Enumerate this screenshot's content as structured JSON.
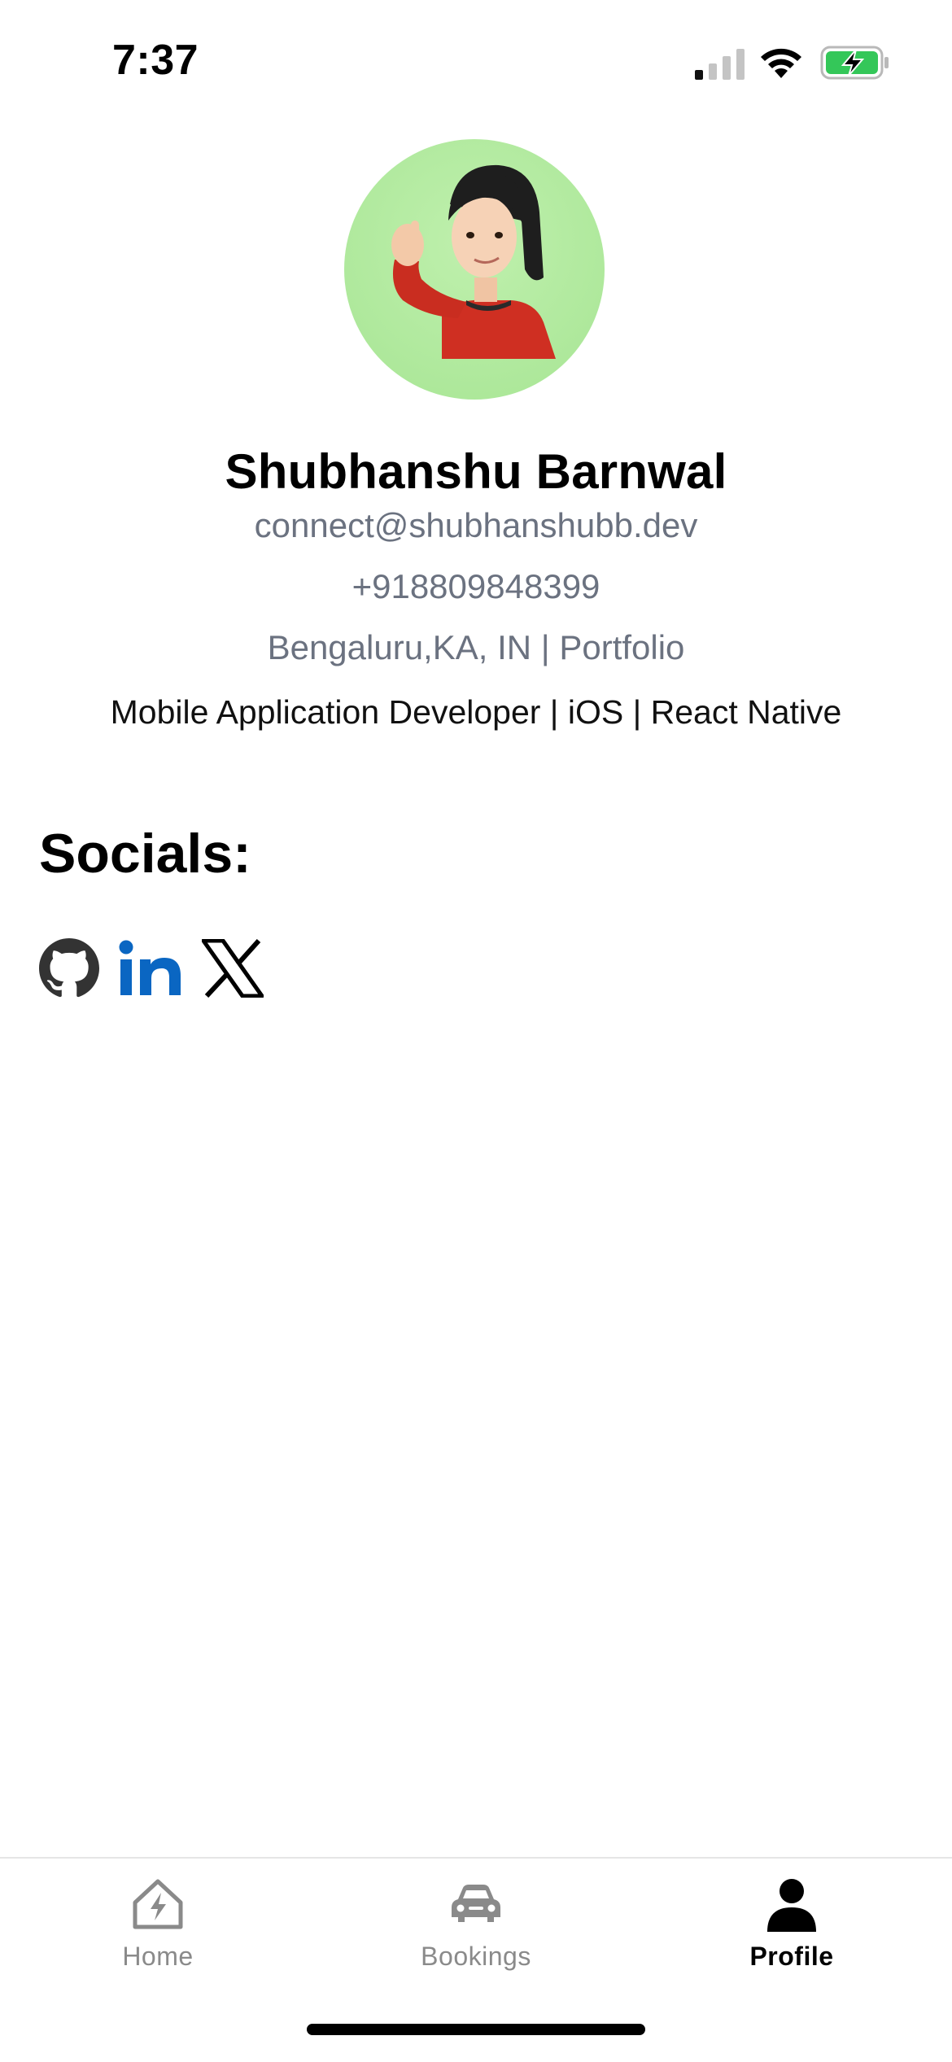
{
  "status_bar": {
    "time": "7:37",
    "icons": [
      "cellular-signal-icon",
      "wifi-icon",
      "battery-charging-icon"
    ]
  },
  "profile": {
    "avatar_icon": "memoji-avatar-icon",
    "avatar_bg": "#b4ea9e",
    "name": "Shubhanshu Barnwal",
    "email": "connect@shubhanshubb.dev",
    "phone": "+918809848399",
    "location": "Bengaluru,KA, IN | Portfolio",
    "tagline": "Mobile Application Developer | iOS | React Native"
  },
  "socials": {
    "title": "Socials:",
    "items": [
      {
        "icon": "github-icon",
        "color": "#333333"
      },
      {
        "icon": "linkedin-icon",
        "color": "#0a66c2"
      },
      {
        "icon": "x-twitter-icon",
        "color": "#000000"
      }
    ]
  },
  "tab_bar": {
    "tabs": [
      {
        "label": "Home",
        "icon": "home-bolt-icon",
        "active": false
      },
      {
        "label": "Bookings",
        "icon": "car-icon",
        "active": false
      },
      {
        "label": "Profile",
        "icon": "person-icon",
        "active": true
      }
    ],
    "active_color": "#000000",
    "inactive_color": "#8a8a8a"
  }
}
